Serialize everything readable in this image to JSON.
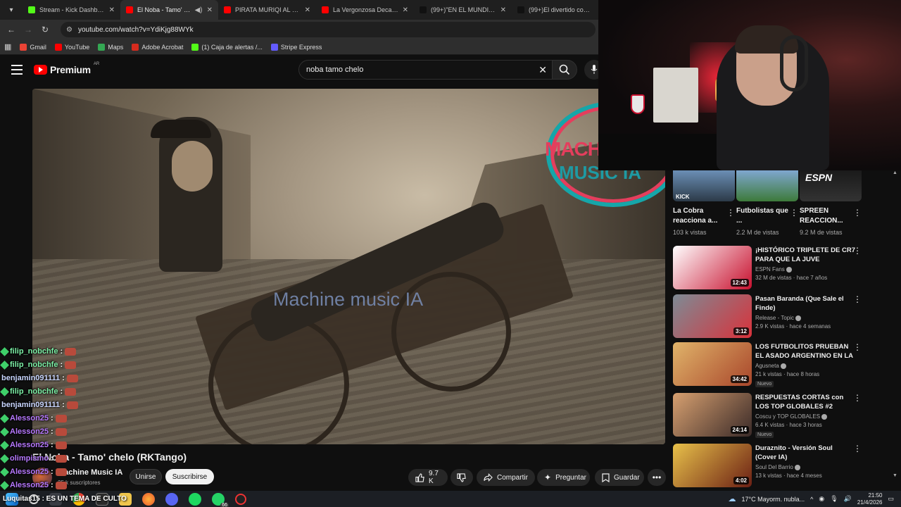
{
  "browser": {
    "tabs": [
      {
        "title": "Stream - Kick Dashboard",
        "favicon_color": "#53fc18",
        "active": false
      },
      {
        "title": "El Noba - Tamo' chelo",
        "favicon_color": "#ff0000",
        "active": true
      },
      {
        "title": "PIRATA MURIQI AL RESCA",
        "favicon_color": "#ff0000",
        "active": false
      },
      {
        "title": "La Vergonzosa Decadenc",
        "favicon_color": "#ff0000",
        "active": false
      },
      {
        "title": "(99+)\"EN EL MUNDIAL LE",
        "favicon_color": "#111111",
        "active": false
      },
      {
        "title": "(99+)El divertido comerci",
        "favicon_color": "#111111",
        "active": false
      }
    ],
    "url": "youtube.com/watch?v=YdiKjg88WYk",
    "bookmarks": [
      {
        "label": "Gmail",
        "color": "#ea4335"
      },
      {
        "label": "YouTube",
        "color": "#ff0000"
      },
      {
        "label": "Maps",
        "color": "#34a853"
      },
      {
        "label": "Adobe Acrobat",
        "color": "#d52b1e"
      },
      {
        "label": "(1) Caja de alertas /...",
        "color": "#53fc18"
      },
      {
        "label": "Stripe Express",
        "color": "#635bff"
      }
    ]
  },
  "youtube": {
    "logo_text": "Premium",
    "country_code": "AR",
    "search_query": "noba tamo chelo"
  },
  "player": {
    "watermark": "Machine music IA",
    "logo_line1": "MACHI",
    "logo_line2": "MUSIC IA"
  },
  "video": {
    "title": "El Noba - Tamo' chelo (RKTango)",
    "channel": "Machine Music IA",
    "subscribers": "25 k suscriptores",
    "join_label": "Unirse",
    "subscribe_label": "Suscribirse",
    "likes": "9.7 K",
    "share_label": "Compartir",
    "ask_label": "Preguntar",
    "save_label": "Guardar"
  },
  "shorts": [
    {
      "title": "La Cobra reacciona a...",
      "views": "103 k vistas"
    },
    {
      "title": "Futbolistas que ...",
      "views": "2.2 M de vistas"
    },
    {
      "title": "SPREEN REACCION...",
      "views": "9.2 M de vistas"
    }
  ],
  "recommendations": [
    {
      "title": "¡HISTÓRICO TRIPLETE DE CR7 PARA QUE LA JUVE REMONTE...",
      "channel": "ESPN Fans",
      "meta": "32 M de vistas · hace 7 años",
      "duration": "12:43",
      "badge": "",
      "colors": [
        "#ffffff",
        "#c8102e"
      ]
    },
    {
      "title": "Pasan Baranda (Que Sale el Finde)",
      "channel": "Release - Topic",
      "meta": "2.9 K vistas · hace 4 semanas",
      "duration": "3:12",
      "badge": "",
      "colors": [
        "#7d8b95",
        "#d9323b"
      ]
    },
    {
      "title": "LOS FUTBOLITOS PRUEBAN EL ASADO ARGENTINO EN LA ...",
      "channel": "Agusneta",
      "meta": "21 k vistas · hace 8 horas",
      "duration": "34:42",
      "badge": "Nuevo",
      "colors": [
        "#e0b46a",
        "#a9462b"
      ]
    },
    {
      "title": "RESPUESTAS CORTAS con LOS TOP GLOBALES #2",
      "channel": "Coscu y TOP GLOBALES",
      "meta": "6.4 K vistas · hace 3 horas",
      "duration": "24:14",
      "badge": "Nuevo",
      "colors": [
        "#d7a070",
        "#3a2a28"
      ]
    },
    {
      "title": "Duraznito - Versión Soul (Cover IA)",
      "channel": "Soul Del Barrio",
      "meta": "13 k vistas · hace 4 meses",
      "duration": "4:02",
      "badge": "",
      "colors": [
        "#e8c14a",
        "#6b1f14"
      ]
    }
  ],
  "chat": [
    {
      "user": "filip_nobchfe",
      "color": "#7cf0a6",
      "badge": true
    },
    {
      "user": "filip_nobchfe",
      "color": "#7cf0a6",
      "badge": true
    },
    {
      "user": "benjamin091111",
      "color": "#c9d6ff",
      "badge": false
    },
    {
      "user": "filip_nobchfe",
      "color": "#7cf0a6",
      "badge": true
    },
    {
      "user": "benjamin091111",
      "color": "#c9d6ff",
      "badge": false
    },
    {
      "user": "Alesson25",
      "color": "#b678ff",
      "badge": true
    },
    {
      "user": "Alesson25",
      "color": "#b678ff",
      "badge": true
    },
    {
      "user": "Alesson25",
      "color": "#b678ff",
      "badge": true
    },
    {
      "user": "olimpismo",
      "color": "#b678ff",
      "badge": true
    },
    {
      "user": "Alesson25",
      "color": "#b678ff",
      "badge": true
    },
    {
      "user": "Alesson25",
      "color": "#b678ff",
      "badge": true
    }
  ],
  "chat_ticker": "Luquitas15 : ES UN TEMA DE CULTO",
  "taskbar": {
    "weather": "17°C  Mayorm. nubla...",
    "time": "21:50",
    "date": "21/4/2026",
    "whatsapp_badge": "66"
  }
}
